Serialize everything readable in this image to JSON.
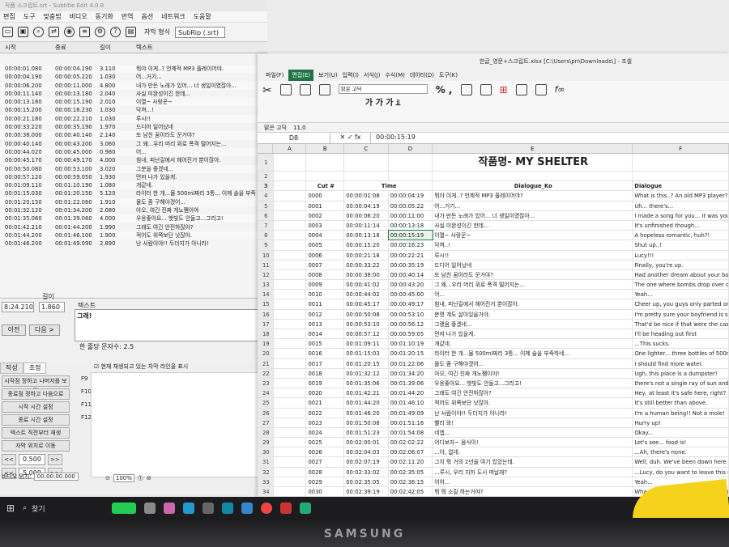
{
  "se": {
    "title": "작품 스크립트.srt - Subtitle Edit 4.0.8",
    "menu": [
      "편집",
      "도구",
      "맞춤법",
      "비디오",
      "동기화",
      "번역",
      "옵션",
      "네트워크",
      "도움말"
    ],
    "format_label": "자막 형식",
    "format_value": "SubRip (.srt)",
    "columns": [
      "시작",
      "종료",
      "길이",
      "텍스트"
    ],
    "rows": [
      [
        "00:00:01.080",
        "00:00:04.190",
        "3.110",
        "뭐야 이게..? 언제적 MP3 플레이어야."
      ],
      [
        "00:00:04.190",
        "00:00:05.220",
        "1.030",
        "어...거기..."
      ],
      [
        "00:00:06.200",
        "00:00:11.000",
        "4.800",
        "내가 만든 노래가 있어... 너 생일이였잖아..."
      ],
      [
        "00:00:11.140",
        "00:00:13.180",
        "2.040",
        "사실 미완성이긴 한데..."
      ],
      [
        "00:00:13.180",
        "00:00:15.190",
        "2.010",
        "이열~ 사랑꾼~"
      ],
      [
        "00:00:15.200",
        "00:00:16.230",
        "1.030",
        "닥쳐...!"
      ],
      [
        "00:00:21.180",
        "00:00:22.210",
        "1.030",
        "루시!!"
      ],
      [
        "00:00:33.220",
        "00:00:35.190",
        "1.970",
        "드디어 일어났네"
      ],
      [
        "00:00:38.000",
        "00:00:40.140",
        "2.140",
        "또 남친 꿈이라도 꾼거야?"
      ],
      [
        "00:00:40.140",
        "00:00:43.200",
        "3.060",
        "그 왜...우리 머리 위로 폭격 떨어지는..."
      ],
      [
        "00:00:44.020",
        "00:00:45.000",
        "0.980",
        "어..."
      ],
      [
        "00:00:45.170",
        "00:00:49.170",
        "4.000",
        "힘내, 피난길에서 헤어진거 뿐이잖아."
      ],
      [
        "00:00:50.080",
        "00:00:53.100",
        "3.020",
        "그분을 좋겠네..."
      ],
      [
        "00:00:57.120",
        "00:00:59.050",
        "1.930",
        "먼저 나가 있을게."
      ],
      [
        "00:01:09.110",
        "00:01:10.190",
        "1.080",
        "개같네."
      ],
      [
        "00:01:15.030",
        "00:01:20.150",
        "5.120",
        "라이터 한 개...물 500ml짜리 3통... 이제 술을 부족"
      ],
      [
        "00:01:20.150",
        "00:01:22.060",
        "1.910",
        "물도 좀 구해야겠어..."
      ],
      [
        "00:01:32.120",
        "00:01:34.200",
        "2.080",
        "아오, 여긴 진짜 개노쨈이야"
      ],
      [
        "00:01:35.060",
        "00:01:39.060",
        "4.000",
        "우웅좋아요... 햇빛도 안들고...그리고!"
      ],
      [
        "00:01:42.210",
        "00:01:44.200",
        "1.990",
        "그래도 여긴 안전하잖아?"
      ],
      [
        "00:01:44.200",
        "00:01:46.100",
        "1.900",
        "적어도 위쪽보단 낫잖아."
      ],
      [
        "00:01:46.200",
        "00:01:49.090",
        "2.890",
        "난 사람이야!! 두더지가 아니라!"
      ]
    ],
    "start_value": "8:24.210",
    "length_label": "길이",
    "duration_value": "1.860",
    "text_label": "텍스트",
    "text_value": "그래!",
    "prev_label": "이전",
    "next_label": "다음 >",
    "char_count": "한 줄당 문자수: 2.5",
    "tabs": [
      "작성",
      "조정"
    ],
    "show_current_label": "현재 재생되고 있는 자막 라인을 표시",
    "side_buttons": [
      "시작점 정하고 나머지를 보정",
      "종료점 정하고 다음으로",
      "시작 시간 설정",
      "종료 시간 설정",
      "텍스트 직전부터 재생",
      "자막 위치로 이동"
    ],
    "fkeys": [
      "F9",
      "F10",
      "F11",
      "F12"
    ],
    "step1": "0.500",
    "step2": "5.000",
    "video_pos_label": "비디오 위치:",
    "video_pos_value": "00:00:00.000",
    "zoom_value": "100%"
  },
  "xl": {
    "title": "한글_영문+스크립트.xlsx [C:\\Users\\pn\\Downloads\\] - 조셀",
    "tabs": [
      "파일(F)",
      "편집(E)",
      "보기(U)",
      "입력(I)",
      "서식(J)",
      "수식(M)",
      "데이터(D)",
      "도구(K)"
    ],
    "font_value": "맑은 고딕",
    "font_size": "11,0",
    "namebox": "D8",
    "formula": "00:00:15:19",
    "columns": [
      "A",
      "B",
      "C",
      "D",
      "E",
      "F"
    ],
    "sheet_title": "작품명- MY SHELTER",
    "headers": {
      "cut": "Cut #",
      "time": "Time",
      "ko": "Dialogue_Ko",
      "en": "Dialogue"
    },
    "rows": [
      [
        "0000",
        "00:00:01:08",
        "00:00:04:19",
        "뭐야 이게..? 언제적 MP3 플레이어야?",
        "What is this..? An old MP3 player?"
      ],
      [
        "0001",
        "00:00:04:19",
        "00:00:05:22",
        "어...거기...",
        "Uh... there's..."
      ],
      [
        "0002",
        "00:00:06:20",
        "00:00:11:00",
        "내가 만든 노래가 있어... 너 생일이였잖아...",
        "I made a song for you... It was your birth"
      ],
      [
        "0003",
        "00:00:11:14",
        "00:00:13:18",
        "사실 미완성이긴 한데...",
        "It's unfinished though..."
      ],
      [
        "0004",
        "00:00:13:18",
        "00:00:15:19",
        "이열~ 사랑꾼~",
        "A hopeless romantic, huh?!"
      ],
      [
        "0005",
        "00:00:15:20",
        "00:00:16:23",
        "닥쳐..!",
        "Shut up..!"
      ],
      [
        "0006",
        "00:00:21:18",
        "00:00:22:21",
        "루시!!",
        "Lucy!!!"
      ],
      [
        "0007",
        "00:00:33:22",
        "00:00:35:19",
        "드디어 일어났네",
        "Finally, you're up."
      ],
      [
        "0008",
        "00:00:38:00",
        "00:00:40:14",
        "또 남친 꿈이라도 꾼거야?",
        "Had another dream about your boyfrienc"
      ],
      [
        "0009",
        "00:00:41:02",
        "00:00:43:20",
        "그 왜...우리 머리 위로 폭격 떨어지는...",
        "The one where bombs drop over our he"
      ],
      [
        "0010",
        "00:00:44:02",
        "00:00:45:00",
        "어...",
        "Yeah..."
      ],
      [
        "0011",
        "00:00:45:17",
        "00:00:49:17",
        "힘내, 피난길에서 헤어진거 뿐이잖아.",
        "Cheer up, you guys only parted on the ev"
      ],
      [
        "0012",
        "00:00:50:08",
        "00:00:53:10",
        "분명 걔도 살아있을거야.",
        "I'm pretty sure your boyfriend is still alive"
      ],
      [
        "0013",
        "00:00:53:10",
        "00:00:56:12",
        "그랬음 좋겠네...",
        "That'd be nice if that were the case..."
      ],
      [
        "0014",
        "00:00:57:12",
        "00:00:59:05",
        "먼저 나가 있을게.",
        "I'll be heading out first"
      ],
      [
        "0015",
        "00:01:09:11",
        "00:01:10:19",
        "개같네.",
        "...This sucks."
      ],
      [
        "0016",
        "00:01:15:03",
        "00:01:20:15",
        "라이터 한 개...물 500ml짜리 3통... 이제 술을 부족하네...",
        "One lighter... three bottles of 500ml water"
      ],
      [
        "0017",
        "00:01:20:15",
        "00:01:22:06",
        "물도 좀 구해야겠어...",
        "I should find more water."
      ],
      [
        "0018",
        "00:01:32:12",
        "00:01:34:20",
        "아오, 여긴 진짜 개노쨈이야!",
        "Ugh, this place is a dumpster!"
      ],
      [
        "0019",
        "00:01:35:06",
        "00:01:39:06",
        "우웅좋아요... 햇빛도 안들고...그리고!",
        "there's not a single ray of sun and!"
      ],
      [
        "0020",
        "00:01:42:21",
        "00:01:44:20",
        "그래도 여긴 안전하잖아?",
        "Hey, at least it's safe here, right?"
      ],
      [
        "0021",
        "00:01:44:20",
        "00:01:46:10",
        "적어도 위쪽보단 낫잖아.",
        "It's still better than above."
      ],
      [
        "0022",
        "00:01:46:20",
        "00:01:49:09",
        "난 사람이야!! 두더지가 아니라!",
        "I'm a human being!! Not a mole!"
      ],
      [
        "0023",
        "00:01:50:08",
        "00:01:51:16",
        "빨리 와!",
        "Hurry up!"
      ],
      [
        "0024",
        "00:01:51:23",
        "00:01:54:08",
        "네엡...",
        "Okay..."
      ],
      [
        "0025",
        "00:02:00:01",
        "00:02:02:22",
        "어디보자~ 음식이!",
        "Let's see... food is!"
      ],
      [
        "0026",
        "00:02:04:03",
        "00:02:06:07",
        "...아, 없네.",
        "...Ah, there's none."
      ],
      [
        "0027",
        "00:02:07:19",
        "00:02:11:20",
        "그치 뭐 거의 2년을 여기 있었는데.",
        "Well, duh. We've been down here for almo"
      ],
      [
        "0028",
        "00:02:33:02",
        "00:02:35:05",
        "...루시, 우리 지하 도시 떠날래?",
        "...Lucy, do you want to leave this undergro"
      ],
      [
        "0029",
        "00:02:35:05",
        "00:02:36:15",
        "어어...",
        "Yeah..."
      ],
      [
        "0030",
        "00:02:39:19",
        "00:02:42:05",
        "뭐 뭐 소릴 하는거야?",
        "Wha, wha, wha, what are you saying"
      ]
    ]
  },
  "taskbar": {
    "search_label": "찾기"
  },
  "bezel": {
    "brand": "SAMSUNG"
  }
}
